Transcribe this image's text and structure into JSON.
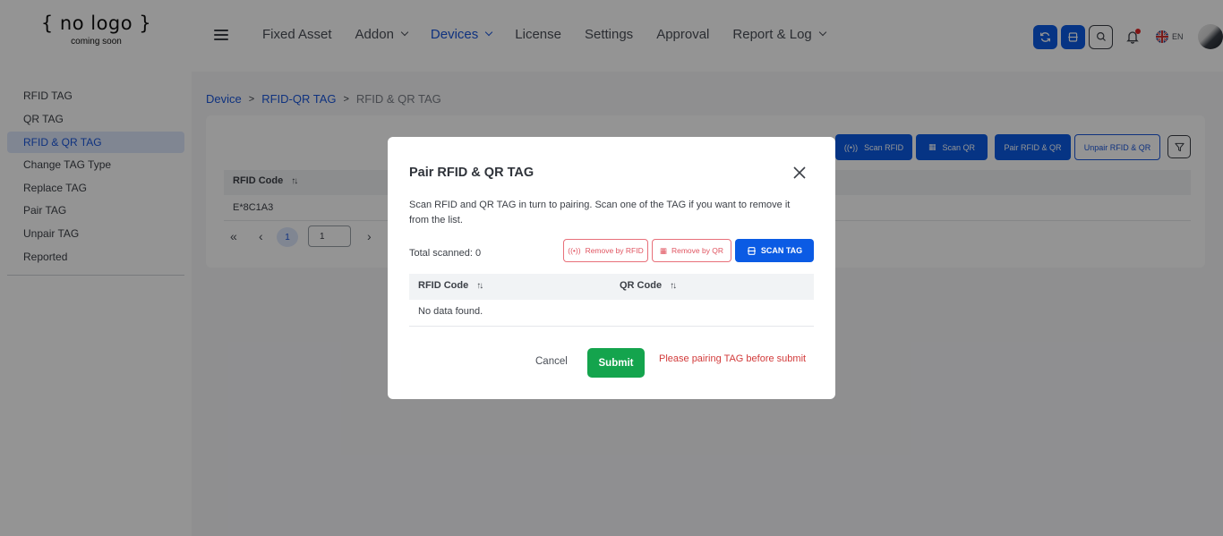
{
  "header": {
    "logo_main": "{ no logo }",
    "logo_sub": "coming soon",
    "nav": [
      {
        "label": "Fixed Asset"
      },
      {
        "label": "Addon"
      },
      {
        "label": "Devices"
      },
      {
        "label": "License"
      },
      {
        "label": "Settings"
      },
      {
        "label": "Approval"
      },
      {
        "label": "Report & Log"
      }
    ],
    "lang": "EN"
  },
  "sidebar": {
    "items": [
      {
        "label": "RFID TAG"
      },
      {
        "label": "QR TAG"
      },
      {
        "label": "RFID & QR TAG"
      },
      {
        "label": "Change TAG Type"
      },
      {
        "label": "Replace TAG"
      },
      {
        "label": "Pair TAG"
      },
      {
        "label": "Unpair TAG"
      },
      {
        "label": "Reported"
      }
    ],
    "active": "RFID & QR TAG"
  },
  "breadcrumb": {
    "items": [
      "Device",
      "RFID-QR TAG",
      "RFID & QR TAG"
    ]
  },
  "toolbar": {
    "scan_rfid": "Scan RFID",
    "scan_qr": "Scan QR",
    "pair": "Pair RFID & QR",
    "unpair": "Unpair RFID & QR"
  },
  "table": {
    "col_rfid": "RFID Code",
    "rows": [
      {
        "rfid": "E*8C1A3"
      }
    ]
  },
  "pagination": {
    "current": "1",
    "input": "1"
  },
  "modal": {
    "title": "Pair RFID & QR TAG",
    "description": "Scan RFID and QR TAG in turn to pairing. Scan one of the TAG if you want to remove it from the list.",
    "total_scanned": "Total scanned: 0",
    "remove_rfid": "Remove by RFID",
    "remove_qr": "Remove by QR",
    "scan_tag": "SCAN TAG",
    "col_rfid": "RFID Code",
    "col_qr": "QR Code",
    "empty": "No data found.",
    "cancel": "Cancel",
    "submit": "Submit",
    "error": "Please pairing TAG before submit"
  },
  "colors": {
    "primary": "#0b5be4",
    "success": "#14a44d",
    "danger": "#d23a3a",
    "link": "#1a56db"
  }
}
